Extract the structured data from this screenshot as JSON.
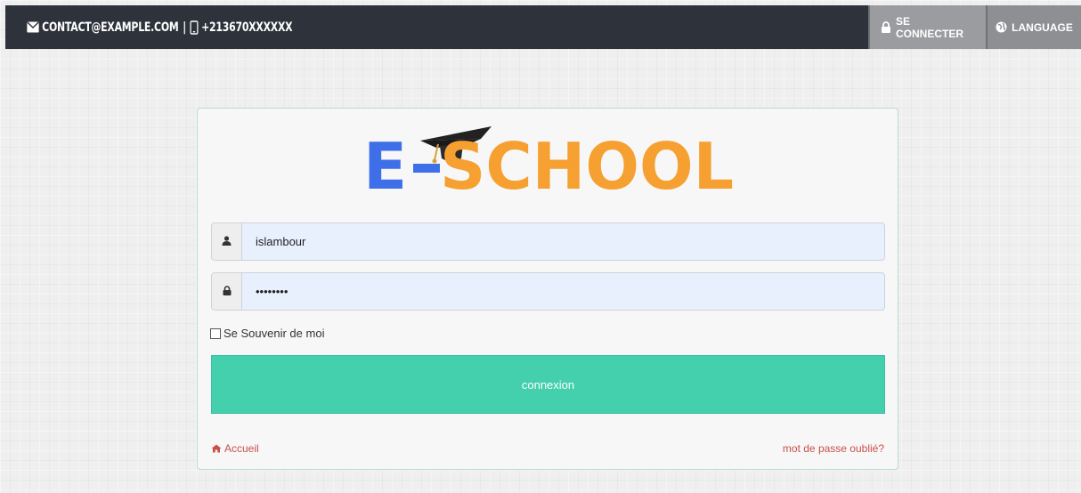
{
  "topbar": {
    "email": "CONTACT@EXAMPLE.COM",
    "separator": "|",
    "phone": "+213670XXXXXX",
    "login_label": "SE CONNECTER",
    "language_label": "LANGUAGE"
  },
  "logo": {
    "text_left": "E",
    "text_right": "SCHOOL",
    "colors": {
      "blue": "#3f6fe8",
      "orange": "#f5a031",
      "cap": "#222222"
    }
  },
  "form": {
    "username_value": "islambour",
    "password_value": "••••••••",
    "remember_label": "Se Souvenir de moi",
    "submit_label": "connexion",
    "home_label": "Accueil",
    "forgot_label": "mot de passe oublié?"
  },
  "icons": {
    "email": "envelope-icon",
    "phone": "mobile-icon",
    "login": "lock-icon",
    "language": "globe-icon",
    "user": "user-icon",
    "password": "lock-icon",
    "home": "home-icon"
  },
  "colors": {
    "topbar_bg": "#2d323b",
    "accent": "#44cfad",
    "link": "#c9504a"
  }
}
